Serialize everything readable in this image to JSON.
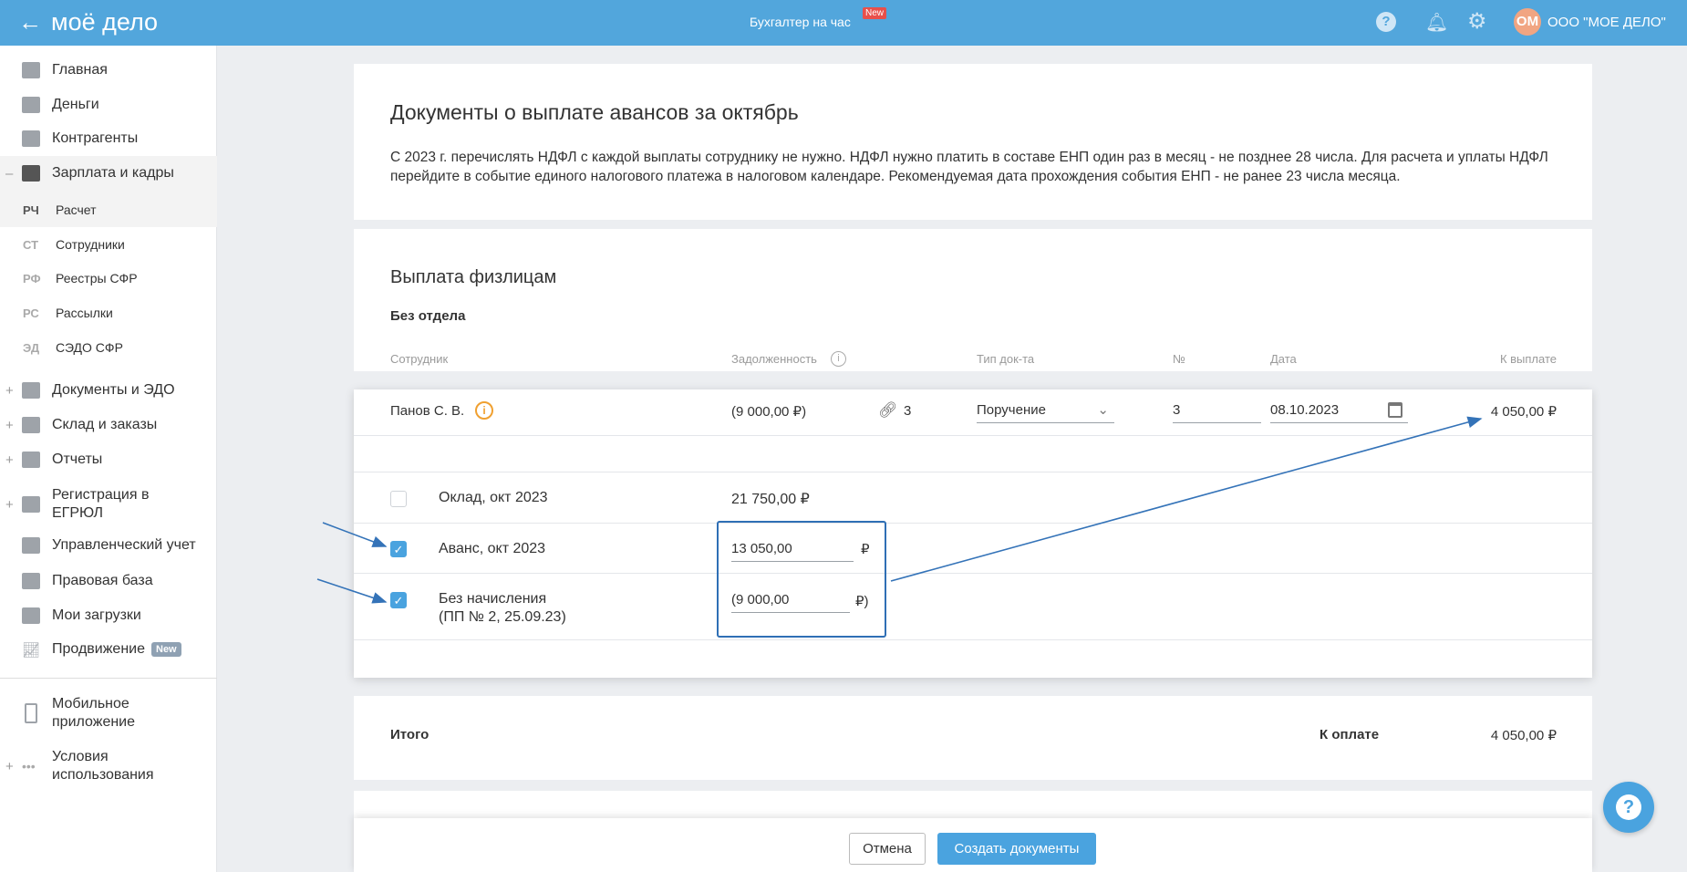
{
  "header": {
    "logo": "моё дело",
    "center_title": "Бухгалтер на час",
    "center_badge": "New",
    "avatar": "ОМ",
    "company": "ООО \"МОЕ ДЕЛО\""
  },
  "sidebar": {
    "items": [
      {
        "label": "Главная"
      },
      {
        "label": "Деньги"
      },
      {
        "label": "Контрагенты"
      },
      {
        "label": "Зарплата и кадры"
      },
      {
        "abbr": "РЧ",
        "label": "Расчет"
      },
      {
        "abbr": "СТ",
        "label": "Сотрудники"
      },
      {
        "abbr": "РФ",
        "label": "Реестры СФР"
      },
      {
        "abbr": "РС",
        "label": "Рассылки"
      },
      {
        "abbr": "ЭД",
        "label": "СЭДО СФР"
      },
      {
        "label": "Документы и ЭДО"
      },
      {
        "label": "Склад и заказы"
      },
      {
        "label": "Отчеты"
      },
      {
        "label": "Регистрация в ЕГРЮЛ"
      },
      {
        "label": "Управленческий учет"
      },
      {
        "label": "Правовая база"
      },
      {
        "label": "Мои загрузки"
      },
      {
        "label": "Продвижение",
        "badge": "New"
      },
      {
        "label": "Мобильное приложение"
      },
      {
        "label": "Условия использования"
      }
    ]
  },
  "intro": {
    "title": "Документы о выплате авансов за октябрь",
    "text": "С 2023 г. перечислять НДФЛ с каждой выплаты сотруднику не нужно. НДФЛ нужно платить в составе ЕНП один раз в месяц - не позднее 28 числа. Для расчета и уплаты НДФЛ перейдите в событие единого налогового платежа в налоговом календаре. Рекомендуемая дата прохождения события ЕНП - не ранее 23 числа месяца."
  },
  "payout": {
    "title": "Выплата физлицам",
    "department": "Без отдела",
    "columns": [
      "Сотрудник",
      "Задолженность",
      "Тип док-та",
      "№",
      "Дата",
      "К выплате"
    ],
    "employee": {
      "name": "Панов С. В.",
      "debt": "(9 000,00 ₽)",
      "links": "3",
      "doc_type": "Поручение",
      "number": "3",
      "date": "08.10.2023",
      "to_pay": "4 050,00 ₽"
    },
    "lines": [
      {
        "label": "Оклад, окт 2023",
        "amount": "21 750,00 ₽",
        "checked": false
      },
      {
        "label": "Аванс, окт 2023",
        "value": "13 050,00",
        "currency": "₽",
        "checked": true
      },
      {
        "label": "Без начисления",
        "sublabel": "(ПП № 2, 25.09.23)",
        "value": "(9 000,00",
        "currency": "₽)",
        "checked": true
      }
    ]
  },
  "total": {
    "label": "Итого",
    "pay_label": "К оплате",
    "pay_value": "4 050,00 ₽"
  },
  "footer": {
    "cancel": "Отмена",
    "create": "Создать документы"
  }
}
